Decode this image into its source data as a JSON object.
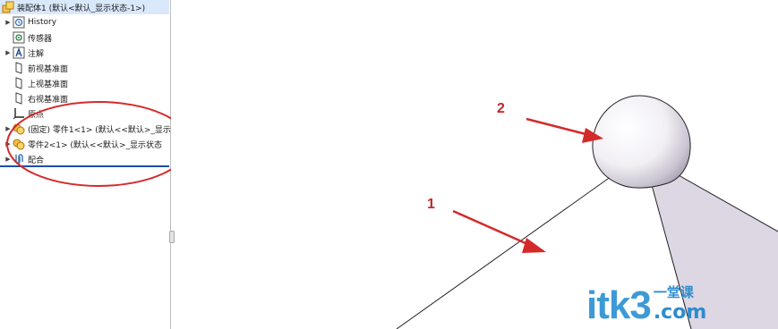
{
  "feature_tree": {
    "root_label": "装配体1 (默认<默认_显示状态-1>)",
    "items": [
      {
        "label": "History",
        "icon": "history-icon",
        "expandable": true
      },
      {
        "label": "传感器",
        "icon": "sensor-icon",
        "expandable": false
      },
      {
        "label": "注解",
        "icon": "annotation-icon",
        "expandable": true
      },
      {
        "label": "前视基准面",
        "icon": "plane-icon",
        "expandable": false
      },
      {
        "label": "上视基准面",
        "icon": "plane-icon",
        "expandable": false
      },
      {
        "label": "右视基准面",
        "icon": "plane-icon",
        "expandable": false
      },
      {
        "label": "原点",
        "icon": "origin-icon",
        "expandable": false
      },
      {
        "label": "(固定) 零件1<1> (默认<<默认>_显示",
        "icon": "part-icon",
        "expandable": true
      },
      {
        "label": "零件2<1> (默认<<默认>_显示状态",
        "icon": "part-icon",
        "expandable": true
      },
      {
        "label": "配合",
        "icon": "mate-icon",
        "expandable": true
      }
    ]
  },
  "graphics_area": {
    "callouts": [
      {
        "number": "2"
      },
      {
        "number": "1"
      }
    ]
  },
  "watermark": {
    "text": "itk3",
    "sub": "一堂课",
    "sub2": ".com"
  },
  "colors": {
    "annotation_red": "#d42a2a",
    "selection_blue": "#d9e8fb",
    "separator_blue": "#1d4fa6",
    "watermark_blue": "#3d9ad6"
  }
}
